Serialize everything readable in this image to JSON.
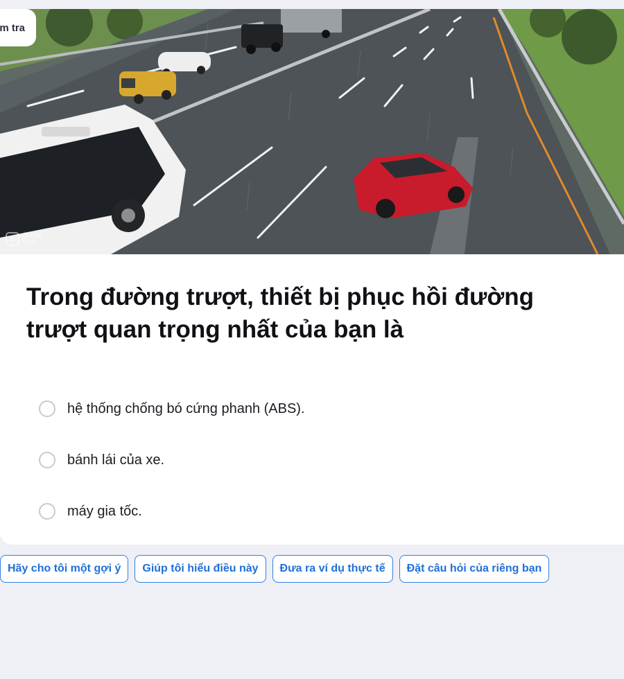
{
  "header": {
    "chip_label": "m tra"
  },
  "hero": {
    "watermark_line1": "driving",
    "watermark_line2": "tests"
  },
  "question": {
    "text": "Trong đường trượt, thiết bị phục hồi đường trượt quan trọng nhất của bạn là"
  },
  "options": [
    {
      "label": "hệ thống chống bó cứng phanh (ABS)."
    },
    {
      "label": "bánh lái của xe."
    },
    {
      "label": "máy gia tốc."
    }
  ],
  "help_chips": [
    {
      "label": "Hãy cho tôi một gợi ý"
    },
    {
      "label": "Giúp tôi hiểu điều này"
    },
    {
      "label": "Đưa ra ví dụ thực tế"
    },
    {
      "label": "Đặt câu hỏi của riêng bạn"
    }
  ],
  "colors": {
    "accent": "#1f6fd6",
    "page_bg": "#eef0f5",
    "card_bg": "#ffffff"
  }
}
